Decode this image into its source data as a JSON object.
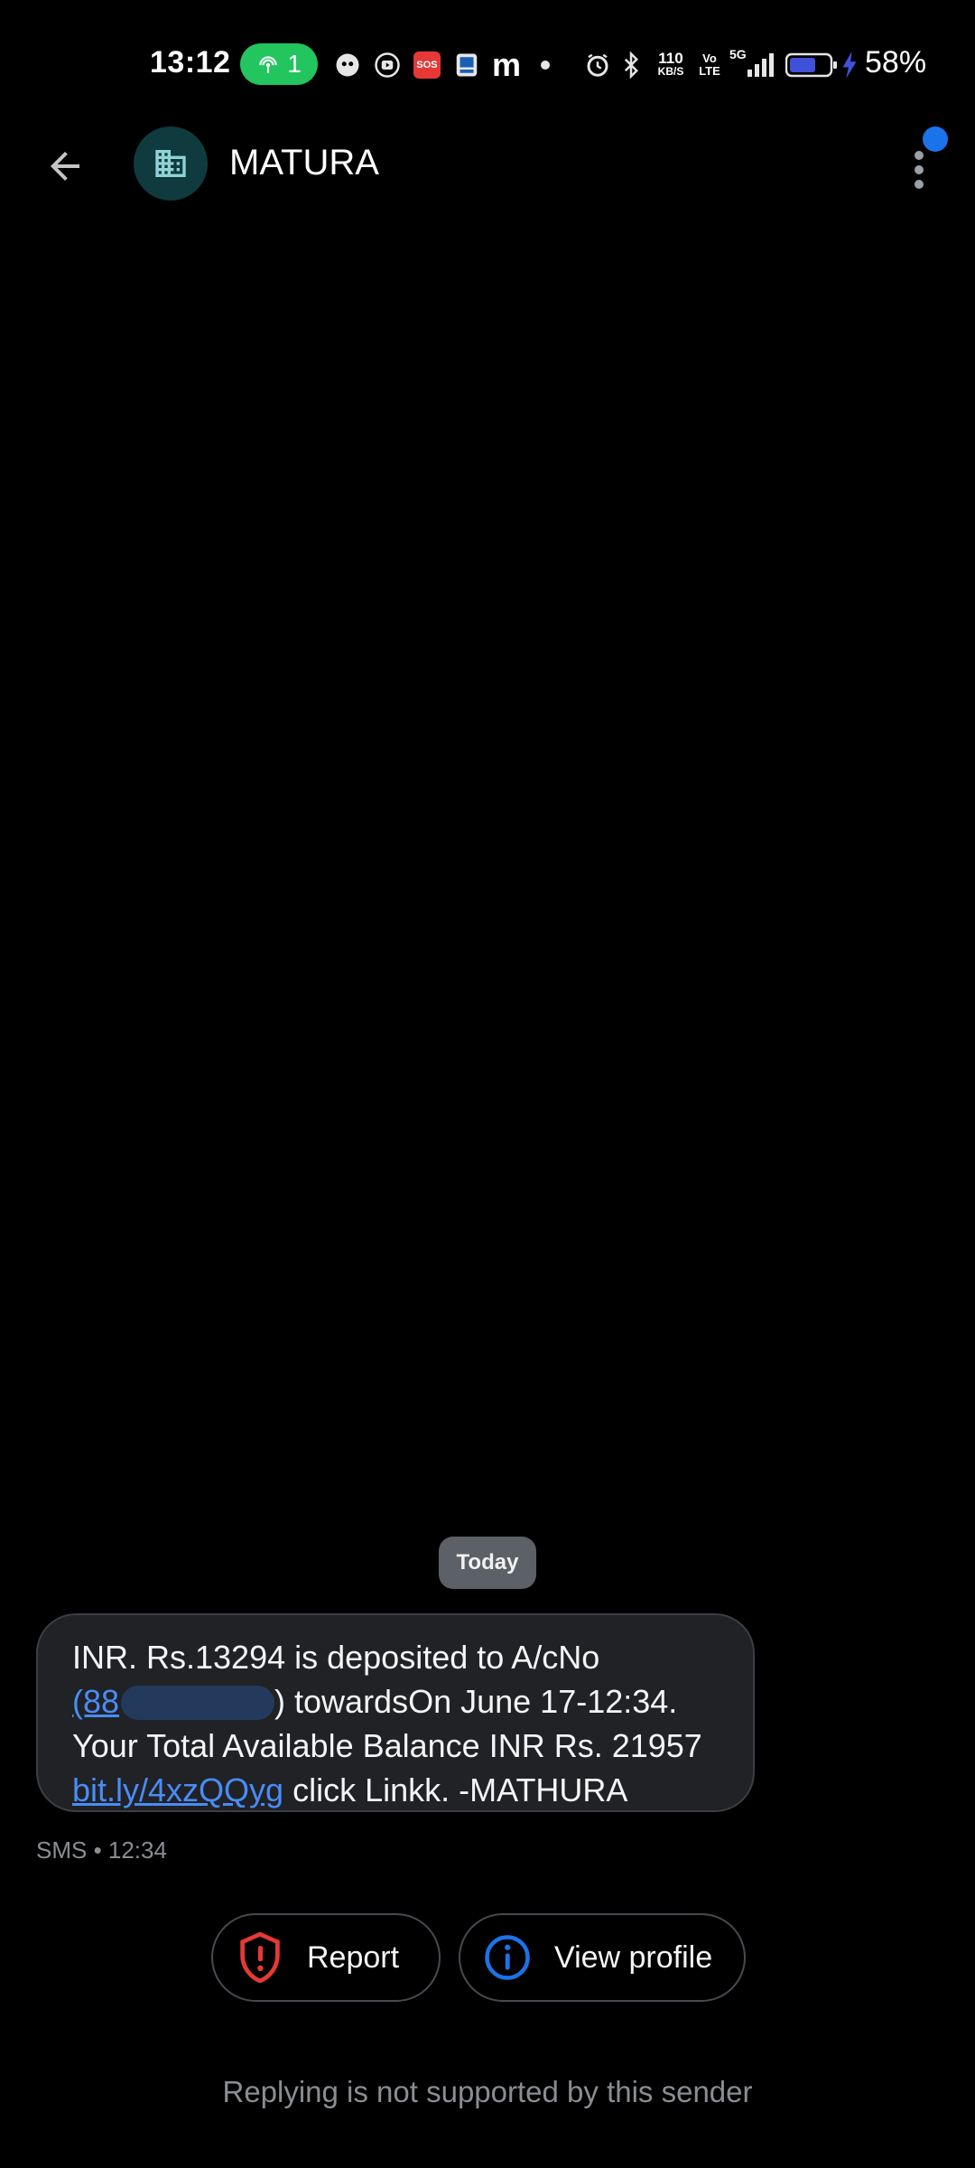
{
  "status_bar": {
    "time": "13:12",
    "hotspot_count": "1",
    "sos_label": "SOS",
    "network_speed_value": "110",
    "network_speed_unit": "KB/S",
    "volte_label": "Vo LTE",
    "signal_label": "5G",
    "battery_percent": "58%",
    "icons": [
      "hotspot-icon",
      "app-notification-icon",
      "play-icon",
      "sos-icon",
      "app-icon",
      "m-icon",
      "dot-icon",
      "alarm-icon",
      "bluetooth-icon",
      "signal-icon",
      "battery-icon",
      "charging-icon"
    ]
  },
  "app_bar": {
    "sender_name": "MATURA",
    "avatar_icon": "business-icon"
  },
  "conversation": {
    "date_label": "Today",
    "message": {
      "line1": "INR. Rs.13294 is deposited to A/cNo",
      "account_link_prefix": "(88",
      "line2_rest": ") towardsOn June 17-12:34.",
      "line3": "Your Total Available Balance INR Rs. 21957",
      "url_link": "bit.ly/4xzQQyg",
      "line4_rest": " click Linkk. -MATHURA"
    },
    "meta": "SMS • 12:34"
  },
  "actions": {
    "report_label": "Report",
    "view_profile_label": "View profile"
  },
  "footer": {
    "reply_note": "Replying is not supported by this sender"
  },
  "colors": {
    "accent": "#1a73e8",
    "link": "#4a8cf7",
    "report_red": "#e53935",
    "hotspot_green": "#22c55e",
    "bubble_bg": "#202226"
  }
}
